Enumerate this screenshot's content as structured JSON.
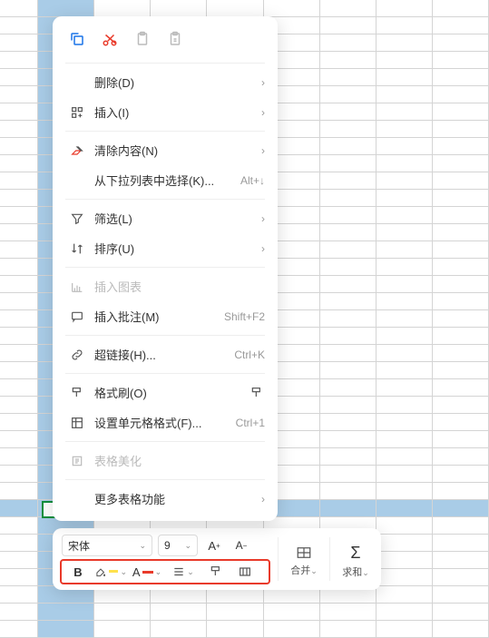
{
  "menu": {
    "delete": "删除(D)",
    "insert": "插入(I)",
    "clear": "清除内容(N)",
    "dropdownList": "从下拉列表中选择(K)...",
    "dropdownListKey": "Alt+↓",
    "filter": "筛选(L)",
    "sort": "排序(U)",
    "insertChart": "插入图表",
    "comment": "插入批注(M)",
    "commentKey": "Shift+F2",
    "hyperlink": "超链接(H)...",
    "hyperlinkKey": "Ctrl+K",
    "formatPainter": "格式刷(O)",
    "formatCells": "设置单元格格式(F)...",
    "formatCellsKey": "Ctrl+1",
    "tableBeautify": "表格美化",
    "moreTable": "更多表格功能"
  },
  "toolbar": {
    "font": "宋体",
    "size": "9",
    "merge": "合并",
    "sum": "求和"
  }
}
